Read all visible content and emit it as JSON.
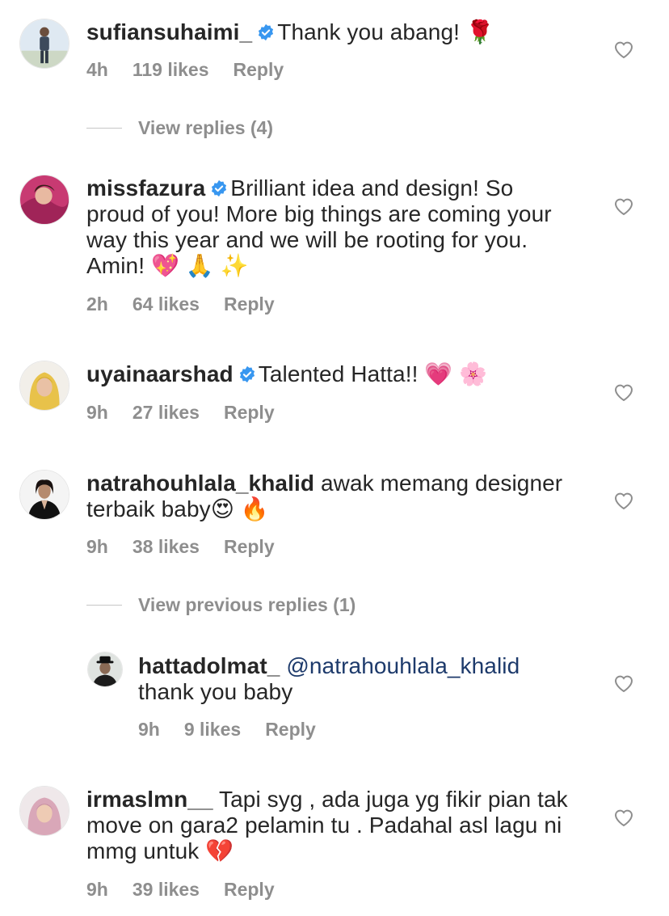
{
  "comments": [
    {
      "username": "sufiansuhaimi_",
      "verified": true,
      "lines": [
        "Thank you abang! 🌹"
      ],
      "time": "4h",
      "likes": "119 likes",
      "reply": "Reply",
      "avatar_icon": "man-standing-avatar"
    },
    {
      "username": "missfazura",
      "verified": true,
      "lines": [
        "Brilliant idea and design! So",
        "proud of you! More big things are coming your",
        "way this year and we will be rooting for you.",
        "Amin! 💖 🙏 ✨"
      ],
      "time": "2h",
      "likes": "64 likes",
      "reply": "Reply",
      "avatar_icon": "woman-pink-avatar"
    },
    {
      "username": "uyainaarshad",
      "verified": true,
      "lines": [
        "Talented Hatta!! 💗 🌸"
      ],
      "time": "9h",
      "likes": "27 likes",
      "reply": "Reply",
      "avatar_icon": "woman-hijab-yellow-avatar"
    },
    {
      "username": "natrahouhlala_khalid",
      "verified": false,
      "lines": [
        "awak memang designer",
        "terbaik baby😍 🔥"
      ],
      "time": "9h",
      "likes": "38 likes",
      "reply": "Reply",
      "avatar_icon": "woman-black-suit-avatar"
    },
    {
      "username": "hattadolmat_",
      "verified": false,
      "mention": "@natrahouhlala_khalid",
      "lines": [
        "thank you baby"
      ],
      "time": "9h",
      "likes": "9 likes",
      "reply": "Reply",
      "avatar_icon": "man-hat-avatar"
    },
    {
      "username": "irmaslmn__",
      "verified": false,
      "lines": [
        "Tapi syg , ada juga yg fikir pian tak",
        "move on gara2 pelamin tu . Padahal asl lagu ni",
        "mmg untuk 💔"
      ],
      "time": "9h",
      "likes": "39 likes",
      "reply": "Reply",
      "avatar_icon": "woman-hijab-pink-avatar"
    }
  ],
  "view_replies": "View replies (4)",
  "view_previous_replies": "View previous replies (1)",
  "colors": {
    "text": "#262626",
    "meta": "#8e8e8e",
    "verified": "#3897f0",
    "mention": "#1d3a6b"
  }
}
